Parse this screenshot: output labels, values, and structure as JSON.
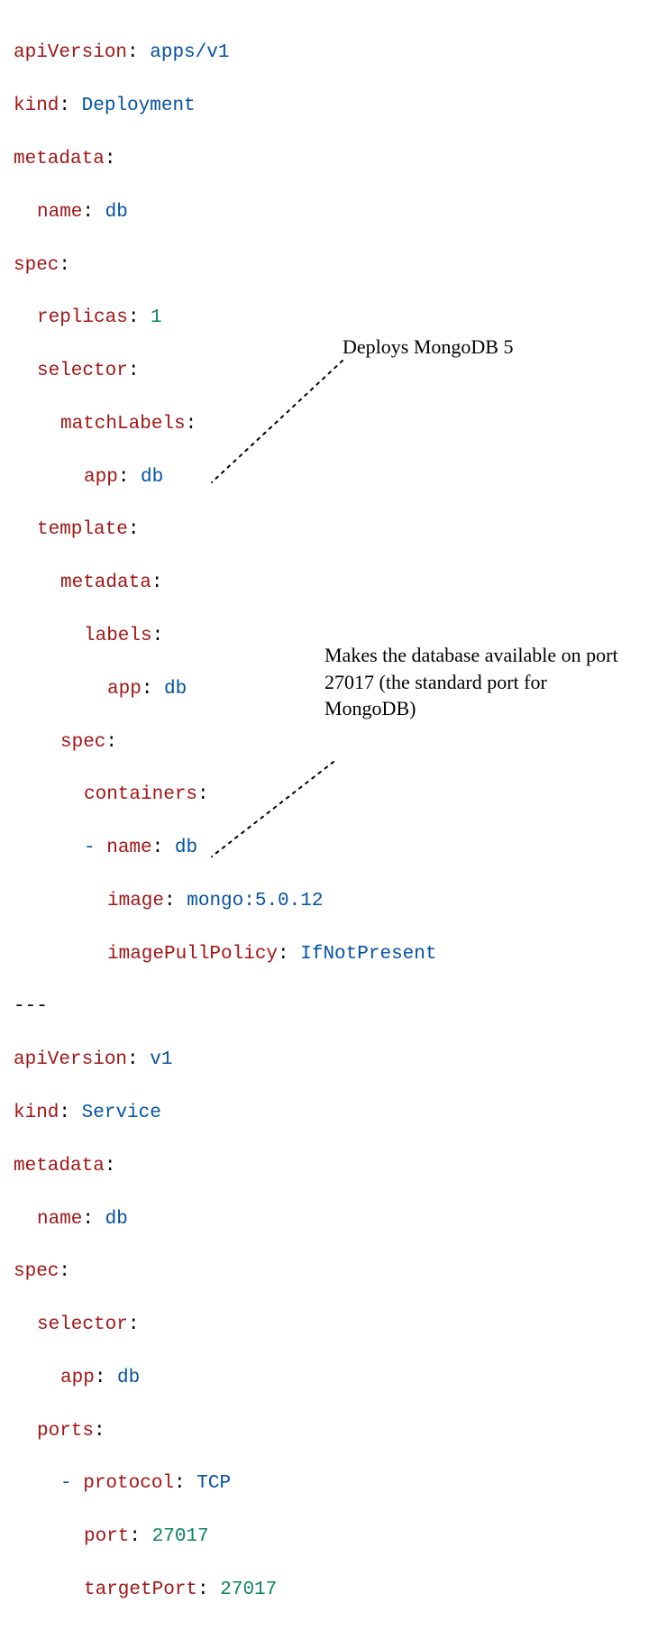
{
  "code": {
    "deployment": {
      "apiVersion": {
        "key": "apiVersion",
        "value": "apps/v1"
      },
      "kind": {
        "key": "kind",
        "value": "Deployment"
      },
      "metadata": {
        "key": "metadata"
      },
      "metadata_name": {
        "key": "name",
        "value": "db"
      },
      "spec": {
        "key": "spec"
      },
      "replicas": {
        "key": "replicas",
        "value": "1"
      },
      "selector": {
        "key": "selector"
      },
      "matchLabels": {
        "key": "matchLabels"
      },
      "matchLabels_app": {
        "key": "app",
        "value": "db"
      },
      "template": {
        "key": "template"
      },
      "template_metadata": {
        "key": "metadata"
      },
      "template_labels": {
        "key": "labels"
      },
      "template_labels_app": {
        "key": "app",
        "value": "db"
      },
      "template_spec": {
        "key": "spec"
      },
      "containers": {
        "key": "containers"
      },
      "container_name": {
        "key": "name",
        "value": "db"
      },
      "container_image": {
        "key": "image",
        "value": "mongo:5.0.12"
      },
      "container_pull": {
        "key": "imagePullPolicy",
        "value": "IfNotPresent"
      }
    },
    "separator": "---",
    "service": {
      "apiVersion": {
        "key": "apiVersion",
        "value": "v1"
      },
      "kind": {
        "key": "kind",
        "value": "Service"
      },
      "metadata": {
        "key": "metadata"
      },
      "metadata_name": {
        "key": "name",
        "value": "db"
      },
      "spec": {
        "key": "spec"
      },
      "selector": {
        "key": "selector"
      },
      "selector_app": {
        "key": "app",
        "value": "db"
      },
      "ports": {
        "key": "ports"
      },
      "port_protocol": {
        "key": "protocol",
        "value": "TCP"
      },
      "port_port": {
        "key": "port",
        "value": "27017"
      },
      "port_targetPort": {
        "key": "targetPort",
        "value": "27017"
      }
    }
  },
  "annotations": {
    "a1": "Deploys MongoDB 5",
    "a2": "Makes the database available on port 27017 (the standard port for MongoDB)"
  },
  "dash": "-"
}
